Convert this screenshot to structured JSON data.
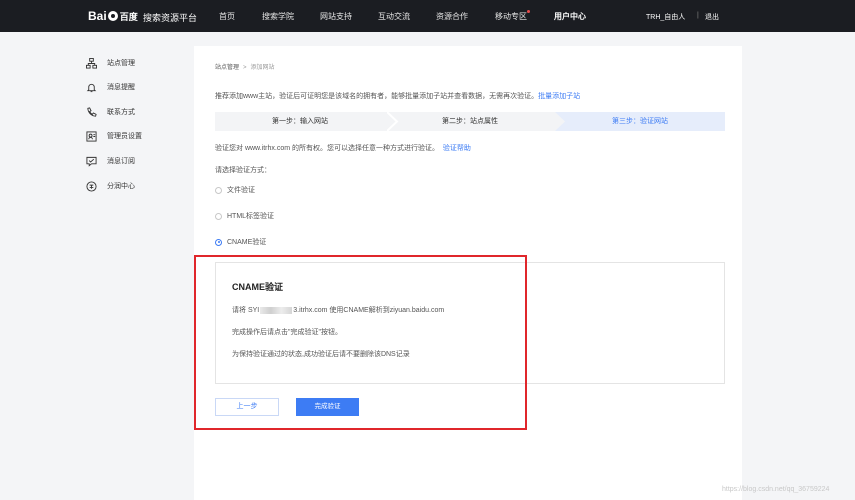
{
  "header": {
    "logo_left": "Bai",
    "logo_right": "百度",
    "platform": "搜索资源平台",
    "nav": [
      {
        "label": "首页"
      },
      {
        "label": "搜索学院"
      },
      {
        "label": "网站支持"
      },
      {
        "label": "互动交流"
      },
      {
        "label": "资源合作"
      },
      {
        "label": "移动专区"
      },
      {
        "label": "用户中心"
      }
    ],
    "user": "TRH_自由人",
    "separator": "|",
    "logout": "退出"
  },
  "sidebar": {
    "items": [
      {
        "label": "站点管理",
        "icon": "sitemap-icon"
      },
      {
        "label": "消息提醒",
        "icon": "bell-icon"
      },
      {
        "label": "联系方式",
        "icon": "phone-icon"
      },
      {
        "label": "管理员设置",
        "icon": "admin-icon"
      },
      {
        "label": "消息订阅",
        "icon": "subscribe-icon"
      },
      {
        "label": "分润中心",
        "icon": "coin-icon"
      }
    ]
  },
  "breadcrumb": {
    "root": "站点管理",
    "arrow": ">",
    "current": "添加网站"
  },
  "intro": {
    "text": "推荐添加www主站，验证后可证明您是该域名的拥有者，能够批量添加子站并查看数据，无需再次验证。",
    "link": "批量添加子站"
  },
  "steps": [
    {
      "label": "第一步：输入网站"
    },
    {
      "label": "第二步：站点属性"
    },
    {
      "label": "第三步：验证网站"
    }
  ],
  "verify": {
    "text": "验证您对 www.itrhx.com 的所有权。您可以选择任意一种方式进行验证。",
    "help": "验证帮助"
  },
  "choose_label": "请选择验证方式：",
  "methods": [
    {
      "label": "文件验证",
      "selected": false
    },
    {
      "label": "HTML标签验证",
      "selected": false
    },
    {
      "label": "CNAME验证",
      "selected": true
    }
  ],
  "card": {
    "title": "CNAME验证",
    "line1_prefix": "请将 SYI",
    "line1_suffix": "3.itrhx.com 使用CNAME解析到ziyuan.baidu.com",
    "line2": "完成操作后请点击\"完成验证\"按钮。",
    "line3": "为保持验证通过的状态,成功验证后请不要删除该DNS记录"
  },
  "buttons": {
    "prev": "上一步",
    "done": "完成验证"
  },
  "watermark": "https://blog.csdn.net/qq_36759224",
  "colors": {
    "accent": "#3d7cf4",
    "highlight": "#e0262b",
    "topbar": "#1b1d22"
  }
}
